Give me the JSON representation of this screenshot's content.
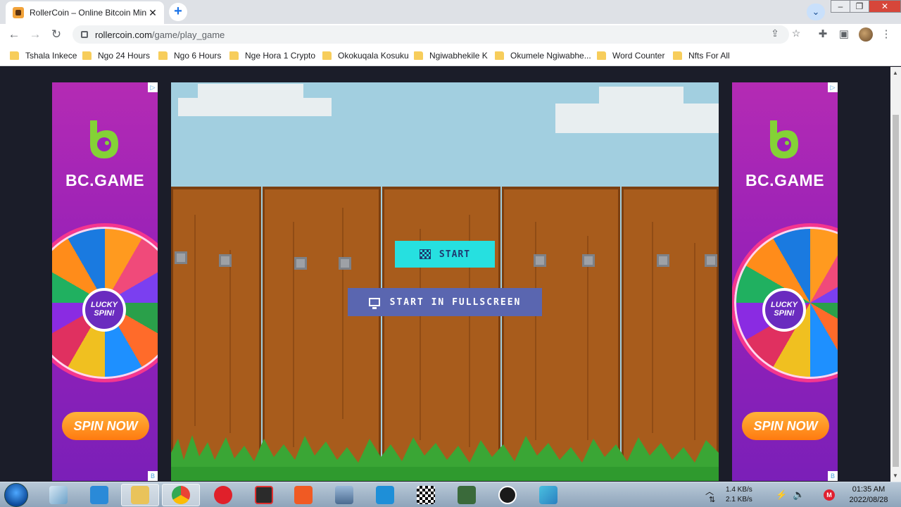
{
  "browser": {
    "tab_title": "RollerCoin – Online Bitcoin Mining",
    "tab_close": "✕",
    "newtab": "+",
    "url_host": "rollercoin.com",
    "url_path": "/game/play_game"
  },
  "bookmarks": [
    {
      "label": "Tshala Inkece"
    },
    {
      "label": "Ngo 24 Hours"
    },
    {
      "label": "Ngo 6 Hours"
    },
    {
      "label": "Nge Hora 1 Crypto"
    },
    {
      "label": "Okokuqala Kosuku"
    },
    {
      "label": "Ngiwabhekile K"
    },
    {
      "label": "Okumele Ngiwabhe..."
    },
    {
      "label": "Word Counter"
    },
    {
      "label": "Nfts For All"
    }
  ],
  "ads": {
    "brand": "BC.GAME",
    "hub_line1": "LUCKY",
    "hub_line2": "SPIN!",
    "cta": "SPIN NOW",
    "adchoice": "▷",
    "badge": "B"
  },
  "game": {
    "start_label": "START",
    "fullscreen_label": "START IN FULLSCREEN"
  },
  "taskbar": {
    "net_up": "1.4 KB/s",
    "net_down": "2.1 KB/s",
    "time": "01:35 AM",
    "date": "2022/08/28"
  },
  "colors": {
    "start_button": "#26e0e0",
    "fullscreen_button": "#5a66b0",
    "fence": "#a85c1c",
    "sky": "#a2cfe0"
  }
}
